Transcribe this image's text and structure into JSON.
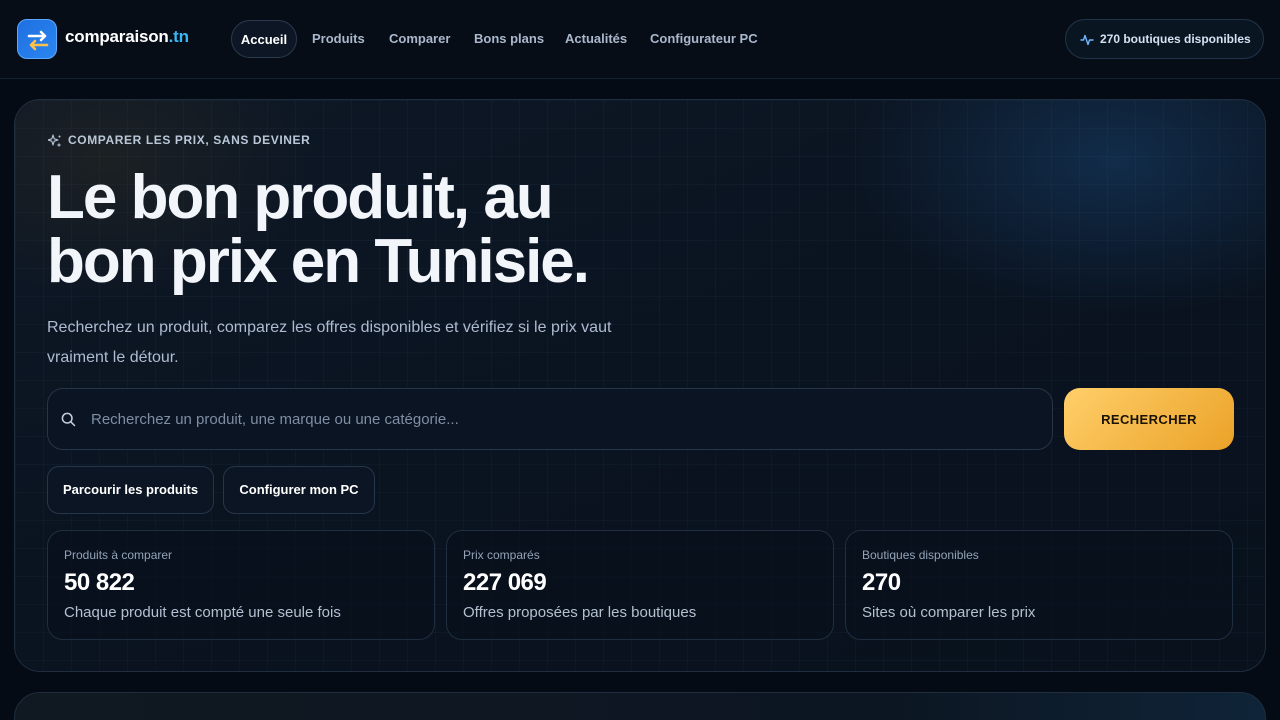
{
  "header": {
    "logo_name": "comparaison",
    "logo_tld": ".tn",
    "nav": [
      {
        "label": "Accueil",
        "active": true
      },
      {
        "label": "Produits"
      },
      {
        "label": "Comparer"
      },
      {
        "label": "Bons plans"
      },
      {
        "label": "Actualités"
      },
      {
        "label": "Configurateur PC"
      }
    ],
    "stores_badge": "270 boutiques disponibles"
  },
  "hero": {
    "eyebrow": "COMPARER LES PRIX, SANS DEVINER",
    "headline": "Le bon produit, au bon prix en Tunisie.",
    "subtitle": "Recherchez un produit, comparez les offres disponibles et vérifiez si le prix vaut vraiment le détour.",
    "search_placeholder": "Recherchez un produit, une marque ou une catégorie...",
    "search_button": "RECHERCHER",
    "secondary_buttons": [
      "Parcourir les produits",
      "Configurer mon PC"
    ],
    "stats": [
      {
        "label": "Produits à comparer",
        "value": "50 822",
        "description": "Chaque produit est compté une seule fois"
      },
      {
        "label": "Prix comparés",
        "value": "227 069",
        "description": "Offres proposées par les boutiques"
      },
      {
        "label": "Boutiques disponibles",
        "value": "270",
        "description": "Sites où comparer les prix"
      }
    ]
  },
  "colors": {
    "accent": "#38b6f5",
    "cta": "#f5b440",
    "background": "#050b14"
  },
  "icons": [
    "swap-arrows-icon",
    "activity-pulse-icon",
    "sparkles-icon",
    "search-icon"
  ]
}
